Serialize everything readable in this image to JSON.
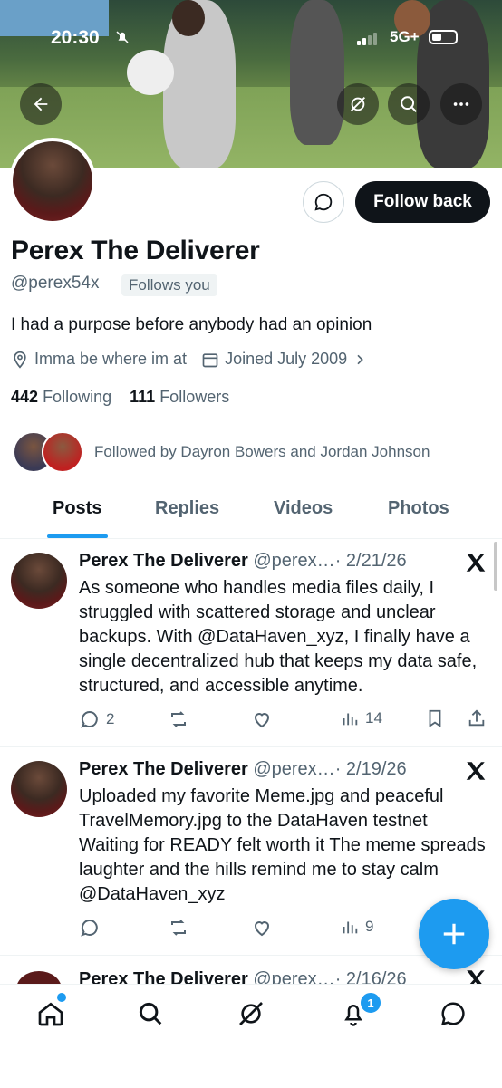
{
  "status_bar": {
    "time": "20:30",
    "network": "5G+"
  },
  "profile": {
    "name": "Perex The Deliverer",
    "handle": "@perex54x",
    "follows_you_label": "Follows you",
    "bio": "I had a purpose before anybody had an opinion",
    "location": "Imma be where im at",
    "joined": "Joined July 2009",
    "following_count": "442",
    "following_label": "Following",
    "followers_count": "111",
    "followers_label": "Followers",
    "followed_by": "Followed by Dayron Bowers and Jordan Johnson",
    "follow_back_label": "Follow back"
  },
  "tabs": [
    {
      "label": "Posts"
    },
    {
      "label": "Replies"
    },
    {
      "label": "Videos"
    },
    {
      "label": "Photos"
    }
  ],
  "posts": [
    {
      "author": "Perex The Deliverer",
      "handle": "@perex…",
      "date": "· 2/21/26",
      "text": "As someone who handles media files daily, I struggled with scattered storage and unclear backups. With @DataHaven_xyz, I finally have a single decentralized hub that keeps my data safe, structured, and accessible anytime.",
      "replies": "2",
      "views": "14"
    },
    {
      "author": "Perex The Deliverer",
      "handle": "@perex…",
      "date": "· 2/19/26",
      "text": "Uploaded my favorite Meme.jpg and peaceful TravelMemory.jpg to the DataHaven testnet Waiting for READY felt worth it The meme spreads laughter and the hills remind me to stay calm @DataHaven_xyz",
      "replies": "",
      "views": "9"
    },
    {
      "author": "Perex The Deliverer",
      "handle": "@perex…",
      "date": "· 2/16/26"
    }
  ],
  "notifications_badge": "1",
  "colors": {
    "accent": "#1d9bf0",
    "text": "#0f1419",
    "secondary": "#536471"
  },
  "icons": [
    "back-arrow-icon",
    "grok-icon",
    "search-icon",
    "more-icon",
    "chat-icon",
    "location-icon",
    "calendar-icon",
    "chevron-right-icon",
    "x-logo-icon",
    "reply-icon",
    "repost-icon",
    "like-icon",
    "views-icon",
    "bookmark-icon",
    "share-icon",
    "plus-icon",
    "home-icon",
    "bell-icon"
  ]
}
